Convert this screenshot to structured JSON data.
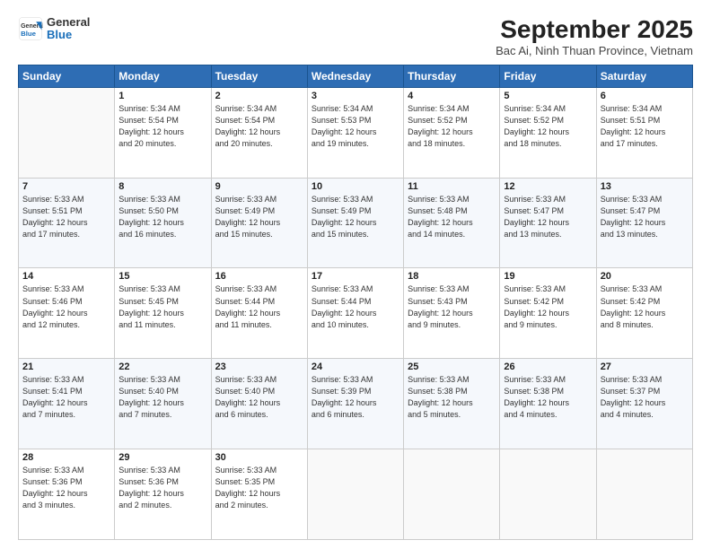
{
  "logo": {
    "general": "General",
    "blue": "Blue"
  },
  "title": "September 2025",
  "subtitle": "Bac Ai, Ninh Thuan Province, Vietnam",
  "days_of_week": [
    "Sunday",
    "Monday",
    "Tuesday",
    "Wednesday",
    "Thursday",
    "Friday",
    "Saturday"
  ],
  "weeks": [
    [
      {
        "num": "",
        "info": ""
      },
      {
        "num": "1",
        "info": "Sunrise: 5:34 AM\nSunset: 5:54 PM\nDaylight: 12 hours\nand 20 minutes."
      },
      {
        "num": "2",
        "info": "Sunrise: 5:34 AM\nSunset: 5:54 PM\nDaylight: 12 hours\nand 20 minutes."
      },
      {
        "num": "3",
        "info": "Sunrise: 5:34 AM\nSunset: 5:53 PM\nDaylight: 12 hours\nand 19 minutes."
      },
      {
        "num": "4",
        "info": "Sunrise: 5:34 AM\nSunset: 5:52 PM\nDaylight: 12 hours\nand 18 minutes."
      },
      {
        "num": "5",
        "info": "Sunrise: 5:34 AM\nSunset: 5:52 PM\nDaylight: 12 hours\nand 18 minutes."
      },
      {
        "num": "6",
        "info": "Sunrise: 5:34 AM\nSunset: 5:51 PM\nDaylight: 12 hours\nand 17 minutes."
      }
    ],
    [
      {
        "num": "7",
        "info": "Sunrise: 5:33 AM\nSunset: 5:51 PM\nDaylight: 12 hours\nand 17 minutes."
      },
      {
        "num": "8",
        "info": "Sunrise: 5:33 AM\nSunset: 5:50 PM\nDaylight: 12 hours\nand 16 minutes."
      },
      {
        "num": "9",
        "info": "Sunrise: 5:33 AM\nSunset: 5:49 PM\nDaylight: 12 hours\nand 15 minutes."
      },
      {
        "num": "10",
        "info": "Sunrise: 5:33 AM\nSunset: 5:49 PM\nDaylight: 12 hours\nand 15 minutes."
      },
      {
        "num": "11",
        "info": "Sunrise: 5:33 AM\nSunset: 5:48 PM\nDaylight: 12 hours\nand 14 minutes."
      },
      {
        "num": "12",
        "info": "Sunrise: 5:33 AM\nSunset: 5:47 PM\nDaylight: 12 hours\nand 13 minutes."
      },
      {
        "num": "13",
        "info": "Sunrise: 5:33 AM\nSunset: 5:47 PM\nDaylight: 12 hours\nand 13 minutes."
      }
    ],
    [
      {
        "num": "14",
        "info": "Sunrise: 5:33 AM\nSunset: 5:46 PM\nDaylight: 12 hours\nand 12 minutes."
      },
      {
        "num": "15",
        "info": "Sunrise: 5:33 AM\nSunset: 5:45 PM\nDaylight: 12 hours\nand 11 minutes."
      },
      {
        "num": "16",
        "info": "Sunrise: 5:33 AM\nSunset: 5:44 PM\nDaylight: 12 hours\nand 11 minutes."
      },
      {
        "num": "17",
        "info": "Sunrise: 5:33 AM\nSunset: 5:44 PM\nDaylight: 12 hours\nand 10 minutes."
      },
      {
        "num": "18",
        "info": "Sunrise: 5:33 AM\nSunset: 5:43 PM\nDaylight: 12 hours\nand 9 minutes."
      },
      {
        "num": "19",
        "info": "Sunrise: 5:33 AM\nSunset: 5:42 PM\nDaylight: 12 hours\nand 9 minutes."
      },
      {
        "num": "20",
        "info": "Sunrise: 5:33 AM\nSunset: 5:42 PM\nDaylight: 12 hours\nand 8 minutes."
      }
    ],
    [
      {
        "num": "21",
        "info": "Sunrise: 5:33 AM\nSunset: 5:41 PM\nDaylight: 12 hours\nand 7 minutes."
      },
      {
        "num": "22",
        "info": "Sunrise: 5:33 AM\nSunset: 5:40 PM\nDaylight: 12 hours\nand 7 minutes."
      },
      {
        "num": "23",
        "info": "Sunrise: 5:33 AM\nSunset: 5:40 PM\nDaylight: 12 hours\nand 6 minutes."
      },
      {
        "num": "24",
        "info": "Sunrise: 5:33 AM\nSunset: 5:39 PM\nDaylight: 12 hours\nand 6 minutes."
      },
      {
        "num": "25",
        "info": "Sunrise: 5:33 AM\nSunset: 5:38 PM\nDaylight: 12 hours\nand 5 minutes."
      },
      {
        "num": "26",
        "info": "Sunrise: 5:33 AM\nSunset: 5:38 PM\nDaylight: 12 hours\nand 4 minutes."
      },
      {
        "num": "27",
        "info": "Sunrise: 5:33 AM\nSunset: 5:37 PM\nDaylight: 12 hours\nand 4 minutes."
      }
    ],
    [
      {
        "num": "28",
        "info": "Sunrise: 5:33 AM\nSunset: 5:36 PM\nDaylight: 12 hours\nand 3 minutes."
      },
      {
        "num": "29",
        "info": "Sunrise: 5:33 AM\nSunset: 5:36 PM\nDaylight: 12 hours\nand 2 minutes."
      },
      {
        "num": "30",
        "info": "Sunrise: 5:33 AM\nSunset: 5:35 PM\nDaylight: 12 hours\nand 2 minutes."
      },
      {
        "num": "",
        "info": ""
      },
      {
        "num": "",
        "info": ""
      },
      {
        "num": "",
        "info": ""
      },
      {
        "num": "",
        "info": ""
      }
    ]
  ]
}
